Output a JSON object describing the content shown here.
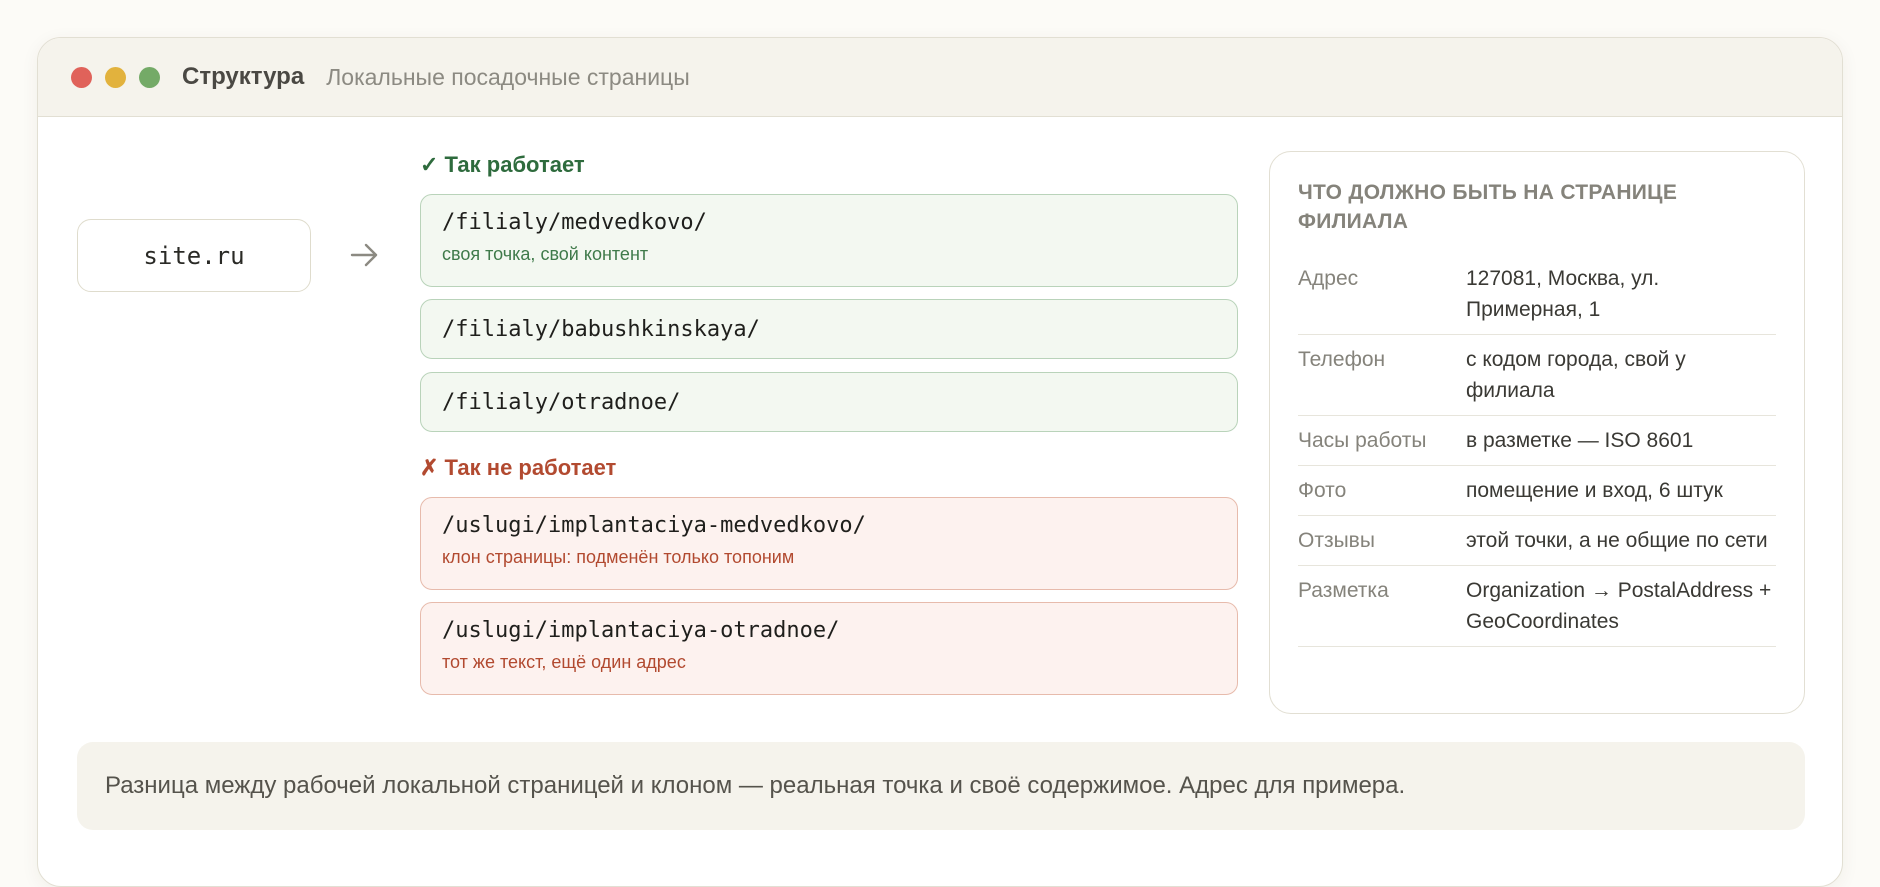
{
  "window": {
    "title": "Структура",
    "subtitle": "Локальные посадочные страницы",
    "controls": [
      "close-dot",
      "minimize-dot",
      "maximize-dot"
    ]
  },
  "diagram": {
    "root": "site.ru",
    "good_heading": "✓ Так работает",
    "good_routes": [
      {
        "path": "/filialy/medvedkovo/",
        "note": "своя точка, свой контент"
      },
      {
        "path": "/filialy/babushkinskaya/",
        "note": ""
      },
      {
        "path": "/filialy/otradnoe/",
        "note": ""
      }
    ],
    "bad_heading": "✗ Так не работает",
    "bad_routes": [
      {
        "path": "/uslugi/implantaciya-medvedkovo/",
        "note": "клон страницы: подменён только топоним"
      },
      {
        "path": "/uslugi/implantaciya-otradnoe/",
        "note": "тот же текст, ещё один адрес"
      }
    ]
  },
  "panel": {
    "title": "Что должно быть на странице филиала",
    "rows": [
      {
        "key": "Адрес",
        "value": "127081, Москва, ул. Примерная, 1"
      },
      {
        "key": "Телефон",
        "value": "с кодом города, свой у филиала"
      },
      {
        "key": "Часы работы",
        "value": "в разметке — ISO 8601"
      },
      {
        "key": "Фото",
        "value": "помещение и вход, 6 штук"
      },
      {
        "key": "Отзывы",
        "value": "этой точки, а не общие по сети"
      },
      {
        "key": "Разметка",
        "value": "Organization → PostalAddress + GeoCoordinates"
      }
    ]
  },
  "footer": {
    "text": "Разница между рабочей локальной страницей и клоном — реальная точка и своё содержимое. Адрес для примера."
  },
  "colors": {
    "ok": "#2e6b3d",
    "bad": "#b24a30",
    "dot_red": "#e0625a",
    "dot_yellow": "#e2b23d",
    "dot_green": "#74aa67"
  }
}
